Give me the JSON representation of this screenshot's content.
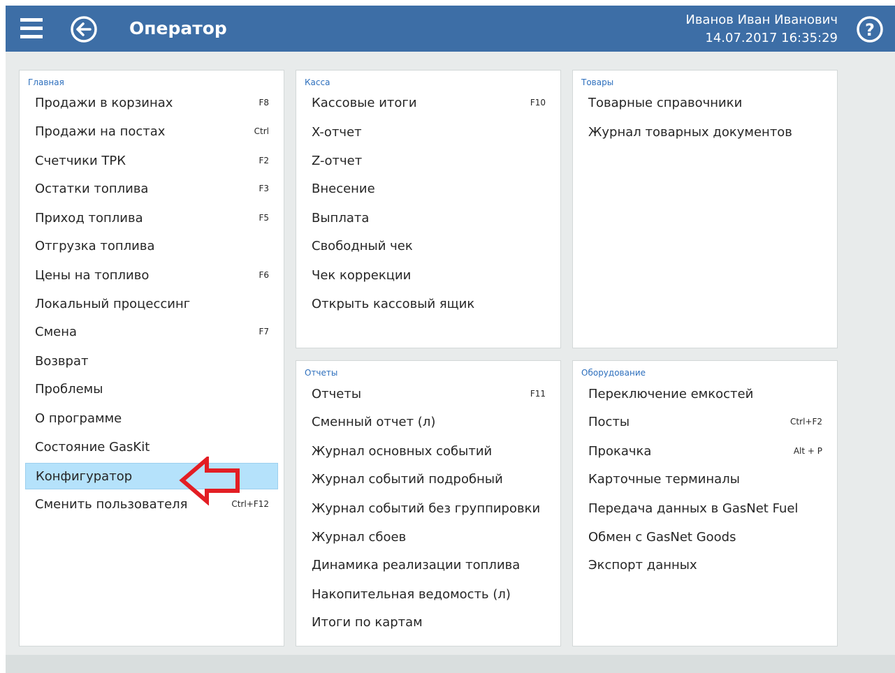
{
  "header": {
    "title": "Оператор",
    "user": "Иванов Иван Иванович",
    "datetime": "14.07.2017 16:35:29",
    "menu_icon": "hamburger-menu-icon",
    "back_icon": "back-arrow-icon",
    "help_icon": "help-icon"
  },
  "colors": {
    "header_bg": "#3d6ea6",
    "section_title": "#2d6fbd",
    "selected_bg": "#b5e2fb",
    "annotation_arrow": "#e31e24"
  },
  "panels": {
    "main": {
      "title": "Главная",
      "items": [
        {
          "label": "Продажи в корзинах",
          "key": "F8"
        },
        {
          "label": "Продажи на постах",
          "key": "Ctrl"
        },
        {
          "label": "Счетчики ТРК",
          "key": "F2"
        },
        {
          "label": "Остатки топлива",
          "key": "F3"
        },
        {
          "label": "Приход топлива",
          "key": "F5"
        },
        {
          "label": "Отгрузка топлива",
          "key": ""
        },
        {
          "label": "Цены на топливо",
          "key": "F6"
        },
        {
          "label": "Локальный процессинг",
          "key": ""
        },
        {
          "label": "Смена",
          "key": "F7"
        },
        {
          "label": "Возврат",
          "key": ""
        },
        {
          "label": "Проблемы",
          "key": ""
        },
        {
          "label": "О программе",
          "key": ""
        },
        {
          "label": "Состояние GasKit",
          "key": ""
        },
        {
          "label": "Конфигуратор",
          "key": "",
          "selected": true
        },
        {
          "label": "Сменить пользователя",
          "key": "Ctrl+F12"
        }
      ]
    },
    "cash": {
      "title": "Касса",
      "items": [
        {
          "label": "Кассовые итоги",
          "key": "F10"
        },
        {
          "label": "X-отчет",
          "key": ""
        },
        {
          "label": "Z-отчет",
          "key": ""
        },
        {
          "label": "Внесение",
          "key": ""
        },
        {
          "label": "Выплата",
          "key": ""
        },
        {
          "label": "Свободный чек",
          "key": ""
        },
        {
          "label": "Чек коррекции",
          "key": ""
        },
        {
          "label": "Открыть кассовый ящик",
          "key": ""
        }
      ]
    },
    "goods": {
      "title": "Товары",
      "items": [
        {
          "label": "Товарные справочники",
          "key": ""
        },
        {
          "label": "Журнал товарных документов",
          "key": ""
        }
      ]
    },
    "reports": {
      "title": "Отчеты",
      "items": [
        {
          "label": "Отчеты",
          "key": "F11"
        },
        {
          "label": "Сменный отчет (л)",
          "key": ""
        },
        {
          "label": "Журнал основных событий",
          "key": ""
        },
        {
          "label": "Журнал событий подробный",
          "key": ""
        },
        {
          "label": "Журнал событий без группировки",
          "key": ""
        },
        {
          "label": "Журнал сбоев",
          "key": ""
        },
        {
          "label": "Динамика реализации топлива",
          "key": ""
        },
        {
          "label": "Накопительная ведомость (л)",
          "key": ""
        },
        {
          "label": "Итоги по картам",
          "key": ""
        }
      ]
    },
    "equipment": {
      "title": "Оборудование",
      "items": [
        {
          "label": "Переключение емкостей",
          "key": ""
        },
        {
          "label": "Посты",
          "key": "Ctrl+F2"
        },
        {
          "label": "Прокачка",
          "key": "Alt + P"
        },
        {
          "label": "Карточные терминалы",
          "key": ""
        },
        {
          "label": "Передача данных в GasNet Fuel",
          "key": ""
        },
        {
          "label": "Обмен с GasNet Goods",
          "key": ""
        },
        {
          "label": "Экспорт данных",
          "key": ""
        }
      ]
    }
  }
}
